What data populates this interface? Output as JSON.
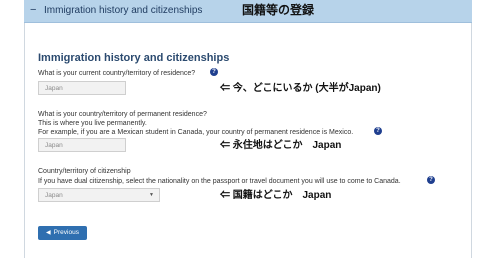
{
  "header": {
    "chevron": "−",
    "title": "Immigration history and citizenships",
    "annotation": "国籍等の登録"
  },
  "section": {
    "title": "Immigration history and citizenships"
  },
  "questions": {
    "current_residence": {
      "label": "What is your current country/territory of residence?",
      "value": "Japan",
      "annotation": "⇐ 今、どこにいるか (大半がJapan)"
    },
    "permanent_residence": {
      "label": "What is your country/territory of permanent residence?",
      "hint_line1": "This is where you live permanently.",
      "hint_line2": "For example, if you are a Mexican student in Canada, your country of permanent residence is Mexico.",
      "value": "Japan",
      "annotation": "⇐ 永住地はどこか　Japan"
    },
    "citizenship": {
      "label": "Country/territory of citizenship",
      "hint": "If you have dual citizenship, select the nationality on the passport or travel document you will use to come to Canada.",
      "selected": "Japan",
      "annotation": "⇐ 国籍はどこか　Japan"
    }
  },
  "help_icon_glyph": "?",
  "buttons": {
    "previous_label": "Previous",
    "previous_icon": "arrow-left-icon"
  },
  "colors": {
    "header_bg": "#b7d3ea",
    "title": "#2b4a6f",
    "button": "#2f6fb0",
    "help_icon": "#1f3f8f"
  }
}
